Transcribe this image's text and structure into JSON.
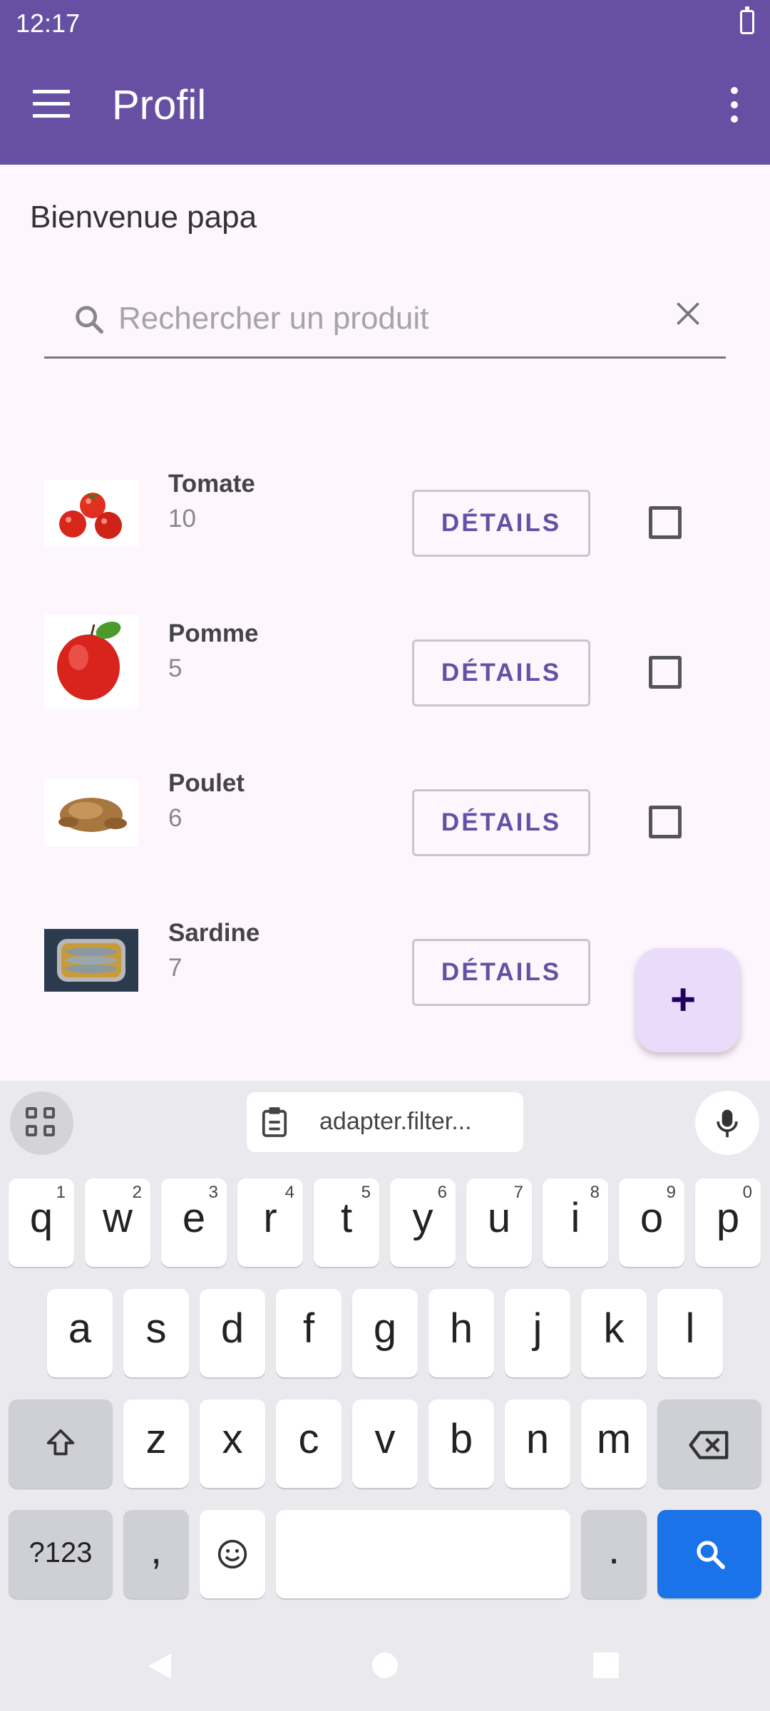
{
  "status": {
    "time": "12:17"
  },
  "appbar": {
    "title": "Profil"
  },
  "welcome": "Bienvenue papa",
  "search": {
    "placeholder": "Rechercher un produit",
    "value": ""
  },
  "products": [
    {
      "name": "Tomate",
      "qty": "10",
      "button": "DÉTAILS"
    },
    {
      "name": "Pomme",
      "qty": "5",
      "button": "DÉTAILS"
    },
    {
      "name": "Poulet",
      "qty": "6",
      "button": "DÉTAILS"
    },
    {
      "name": "Sardine",
      "qty": "7",
      "button": "DÉTAILS"
    }
  ],
  "fab": {
    "label": "+"
  },
  "keyboard": {
    "clipboard": "adapter.filter...",
    "row1": [
      {
        "k": "q",
        "n": "1"
      },
      {
        "k": "w",
        "n": "2"
      },
      {
        "k": "e",
        "n": "3"
      },
      {
        "k": "r",
        "n": "4"
      },
      {
        "k": "t",
        "n": "5"
      },
      {
        "k": "y",
        "n": "6"
      },
      {
        "k": "u",
        "n": "7"
      },
      {
        "k": "i",
        "n": "8"
      },
      {
        "k": "o",
        "n": "9"
      },
      {
        "k": "p",
        "n": "0"
      }
    ],
    "row2": [
      "a",
      "s",
      "d",
      "f",
      "g",
      "h",
      "j",
      "k",
      "l"
    ],
    "row3": [
      "z",
      "x",
      "c",
      "v",
      "b",
      "n",
      "m"
    ],
    "sym": "?123",
    "comma": ",",
    "period": "."
  },
  "colors": {
    "primary": "#6750a4",
    "fab": "#eadbfb",
    "action": "#1a73e8"
  }
}
